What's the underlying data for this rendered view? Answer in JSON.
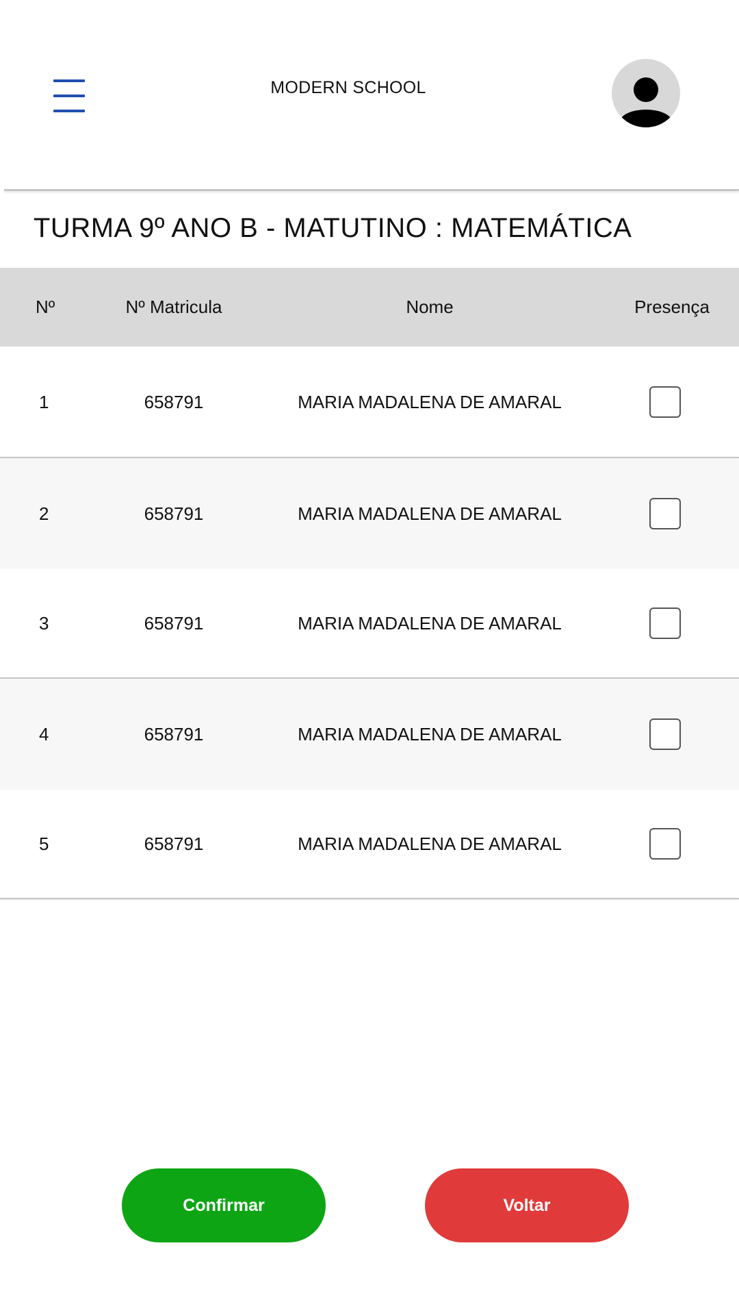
{
  "header": {
    "title": "MODERN SCHOOL",
    "menu_icon": "hamburger-menu-icon",
    "avatar_icon": "user-avatar-icon"
  },
  "class_title": "TURMA 9º ANO B - MATUTINO : MATEMÁTICA",
  "table": {
    "columns": [
      "Nº",
      "Nº Matricula",
      "Nome",
      "Presença"
    ],
    "rows": [
      {
        "num": "1",
        "matricula": "658791",
        "nome": "MARIA MADALENA DE AMARAL",
        "presenca": false
      },
      {
        "num": "2",
        "matricula": "658791",
        "nome": "MARIA MADALENA DE AMARAL",
        "presenca": false
      },
      {
        "num": "3",
        "matricula": "658791",
        "nome": "MARIA MADALENA DE AMARAL",
        "presenca": false
      },
      {
        "num": "4",
        "matricula": "658791",
        "nome": "MARIA MADALENA DE AMARAL",
        "presenca": false
      },
      {
        "num": "5",
        "matricula": "658791",
        "nome": "MARIA MADALENA DE AMARAL",
        "presenca": false
      }
    ]
  },
  "actions": {
    "confirm_label": "Confirmar",
    "back_label": "Voltar"
  },
  "colors": {
    "menu_icon": "#1f4fb0",
    "table_header_bg": "#d9d9d9",
    "row_alt_bg": "#f7f7f7",
    "confirm_button": "#0ea514",
    "back_button": "#e03a3a"
  }
}
